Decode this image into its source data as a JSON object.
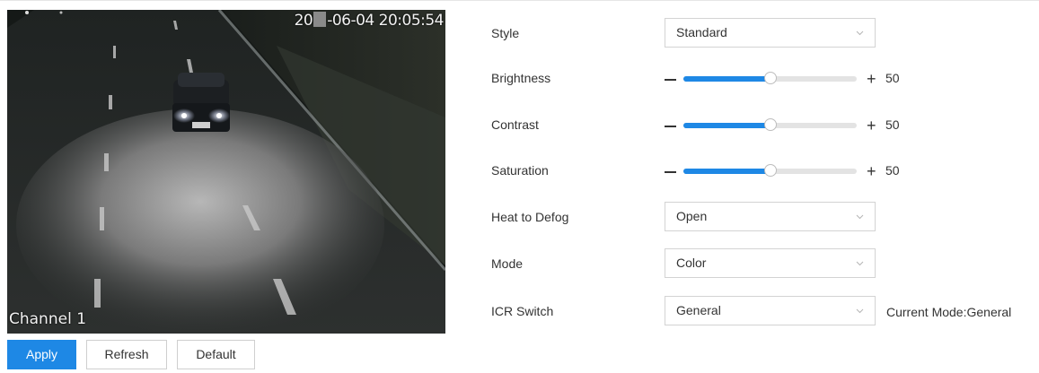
{
  "video": {
    "timestamp_prefix": "20",
    "timestamp_suffix": "-06-04 20:05:54",
    "channel_label": "Channel 1"
  },
  "settings": {
    "style": {
      "label": "Style",
      "value": "Standard"
    },
    "brightness": {
      "label": "Brightness",
      "value": "50",
      "level": 0.5,
      "minus": "−",
      "plus": "+"
    },
    "contrast": {
      "label": "Contrast",
      "value": "50",
      "level": 0.5,
      "minus": "−",
      "plus": "+"
    },
    "saturation": {
      "label": "Saturation",
      "value": "50",
      "level": 0.5,
      "minus": "−",
      "plus": "+"
    },
    "heat_to_defog": {
      "label": "Heat to Defog",
      "value": "Open"
    },
    "mode": {
      "label": "Mode",
      "value": "Color"
    },
    "icr_switch": {
      "label": "ICR Switch",
      "value": "General",
      "current_mode": "Current Mode:General"
    }
  },
  "buttons": {
    "apply": "Apply",
    "refresh": "Refresh",
    "default": "Default"
  },
  "colors": {
    "accent": "#1e88e5",
    "track": "#e3e3e3",
    "border": "#d3d3d3"
  },
  "icons": {
    "select_arrow": "chevron-down-icon"
  }
}
